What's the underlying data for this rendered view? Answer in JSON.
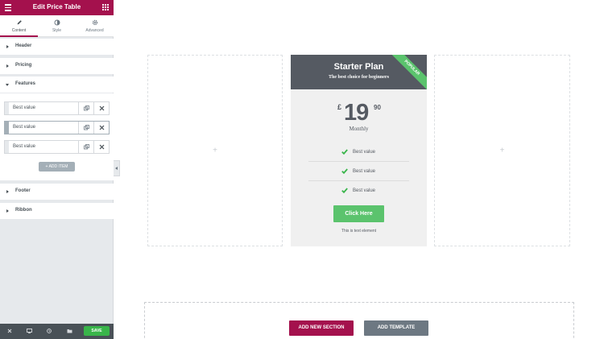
{
  "panel": {
    "title": "Edit Price Table",
    "tabs": [
      {
        "label": "Content",
        "icon": "pencil-icon"
      },
      {
        "label": "Style",
        "icon": "contrast-icon"
      },
      {
        "label": "Advanced",
        "icon": "gear-icon"
      }
    ],
    "sections": {
      "header": "Header",
      "pricing": "Pricing",
      "features": "Features",
      "footer": "Footer",
      "ribbon": "Ribbon"
    },
    "feature_items": [
      {
        "value": "Best value"
      },
      {
        "value": "Best value"
      },
      {
        "value": "Best value"
      }
    ],
    "add_item_label": "+ ADD ITEM",
    "save_label": "SAVE",
    "colors": {
      "brand": "#a4114d",
      "save": "#39b54a"
    }
  },
  "price_table": {
    "title": "Starter Plan",
    "subtitle": "The best choice for beginners",
    "ribbon": "POPULAR",
    "currency": "£",
    "price_int": "19",
    "price_fraction": "90",
    "period": "Monthly",
    "features": [
      "Best value",
      "Best value",
      "Best value"
    ],
    "button_label": "Click Here",
    "footer_note": "This is text element",
    "colors": {
      "header": "#555a62",
      "accent": "#5bc36d"
    }
  },
  "canvas": {
    "placeholder_symbol": "+",
    "add_section_label": "ADD NEW SECTION",
    "add_template_label": "ADD TEMPLATE"
  }
}
